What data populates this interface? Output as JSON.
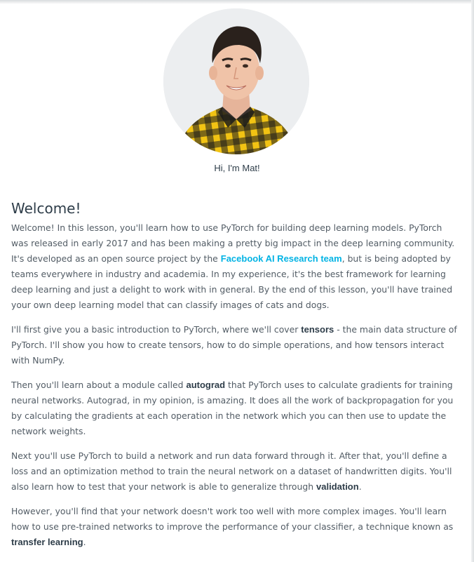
{
  "instructor": {
    "caption": "Hi, I'm Mat!",
    "photo_icon": "instructor-portrait",
    "colors": {
      "shirt_yellow": "#f2c313",
      "shirt_black": "#1b1b1b",
      "background": "#eceef0"
    }
  },
  "lesson": {
    "title": "Welcome!",
    "p1": {
      "t1": "Welcome! In this lesson, you'll learn how to use PyTorch for building deep learning models. PyTorch was released in early 2017 and has been making a pretty big impact in the deep learning community. It's developed as an open source project by the ",
      "link": "Facebook AI Research team",
      "t2": ", but is being adopted by teams everywhere in industry and academia. In my experience, it's the best framework for learning deep learning and just a delight to work with in general. By the end of this lesson, you'll have trained your own deep learning model that can classify images of cats and dogs."
    },
    "p2": {
      "t1": "I'll first give you a basic introduction to PyTorch, where we'll cover ",
      "b1": "tensors",
      "t2": " - the main data structure of PyTorch. I'll show you how to create tensors, how to do simple operations, and how tensors interact with NumPy."
    },
    "p3": {
      "t1": "Then you'll learn about a module called ",
      "b1": "autograd",
      "t2": " that PyTorch uses to calculate gradients for training neural networks. Autograd, in my opinion, is amazing. It does all the work of backpropagation for you by calculating the gradients at each operation in the network which you can then use to update the network weights."
    },
    "p4": {
      "t1": "Next you'll use PyTorch to build a network and run data forward through it. After that, you'll define a loss and an optimization method to train the neural network on a dataset of handwritten digits. You'll also learn how to test that your network is able to generalize through ",
      "b1": "validation",
      "t2": "."
    },
    "p5": {
      "t1": "However, you'll find that your network doesn't work too well with more complex images. You'll learn how to use pre-trained networks to improve the performance of your classifier, a technique known as ",
      "b1": "transfer learning",
      "t2": "."
    }
  },
  "colors": {
    "link": "#02b3e4",
    "heading": "#2e3d49",
    "body_text": "#525c65"
  }
}
